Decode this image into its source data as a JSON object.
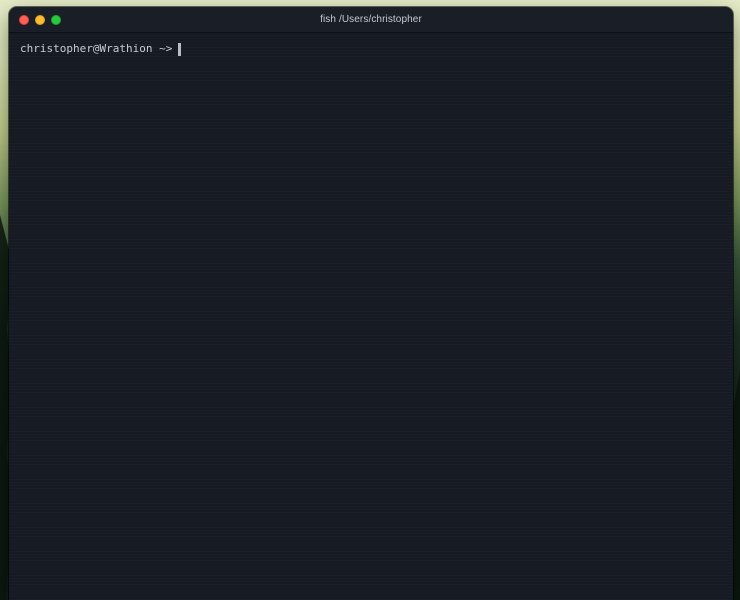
{
  "window": {
    "title": "fish /Users/christopher"
  },
  "terminal": {
    "prompt_user_host": "christopher@Wrathion",
    "prompt_cwd": "~",
    "prompt_symbol": ">"
  },
  "colors": {
    "terminal_background": "#161a22",
    "titlebar_background": "#1a1e27",
    "text": "#c9ccd3",
    "close": "#fe5f57",
    "minimize": "#febc2e",
    "maximize": "#28c840"
  },
  "icons": {
    "close": "close-circle",
    "minimize": "minimize-circle",
    "maximize": "maximize-circle"
  }
}
